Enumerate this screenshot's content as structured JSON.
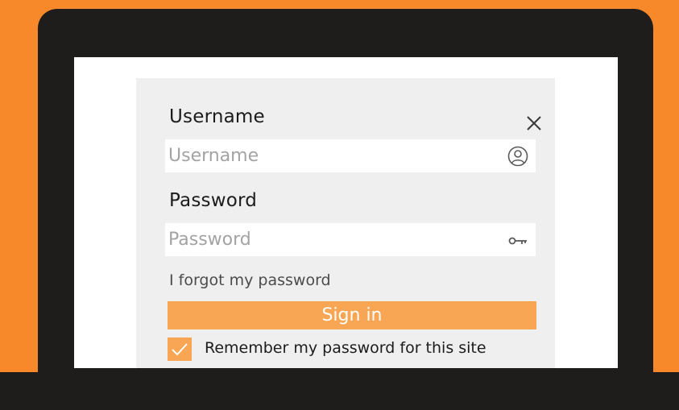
{
  "login_dialog": {
    "username": {
      "label": "Username",
      "placeholder": "Username",
      "value": "",
      "icon": "user-circle-icon"
    },
    "password": {
      "label": "Password",
      "placeholder": "Password",
      "value": "",
      "icon": "key-icon"
    },
    "forgot_link": "I forgot my password",
    "sign_in_label": "Sign in",
    "remember_me": {
      "label": "Remember my password for this site",
      "checked": true
    },
    "close_icon": "close-icon"
  },
  "colors": {
    "background": "#f7892b",
    "laptop": "#1e1d1b",
    "dialog": "#efefef",
    "accent": "#f8a653"
  }
}
